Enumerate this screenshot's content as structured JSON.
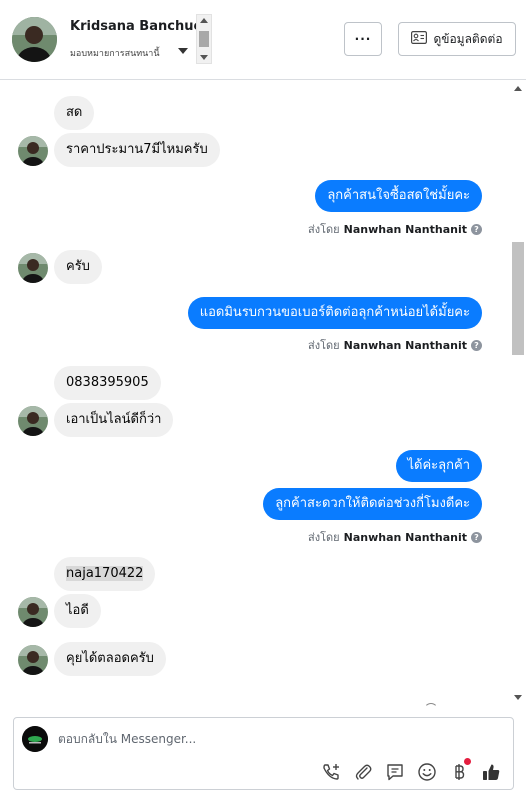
{
  "header": {
    "contact_name": "Kridsana Banchuen",
    "assigned_to": "มอบหมายการสนทนานี้",
    "more_button": "···",
    "contact_info_button": "ดูข้อมูลติดต่อ"
  },
  "messages": {
    "m1": "สด",
    "m2": "ราคาประมาน7มีไหมครับ",
    "m3": "ลุกค้าสนใจซื้อสดใช่มั้ยคะ",
    "m4": "ครับ",
    "m5": "แอดมินรบกวนขอเบอร์ติดต่อลุกค้าหน่อยได้มั้ยคะ",
    "m6": "0838395905",
    "m7": "เอาเป็นไลน์ดีก็ว่า",
    "m8": "ได้ค่ะลุกค้า",
    "m9": "ลูกค้าสะดวกให้ติดต่อช่วงกี่โมงดีคะ",
    "m10": "naja170422",
    "m11": "ไอดี",
    "m12": "คุยได้ตลอดครับ"
  },
  "sent_by": {
    "prefix": "ส่งโดย",
    "agent": "Nanwhan Nanthanit",
    "help": "?"
  },
  "composer": {
    "placeholder": "ตอบกลับใน Messenger..."
  },
  "icons": [
    "call-add-icon",
    "attachment-icon",
    "quick-reply-icon",
    "emoji-icon",
    "payment-icon",
    "like-icon"
  ],
  "colors": {
    "accent": "#0a7cff",
    "incoming_bubble": "#f0f0f0",
    "notification": "#e41e3f"
  }
}
